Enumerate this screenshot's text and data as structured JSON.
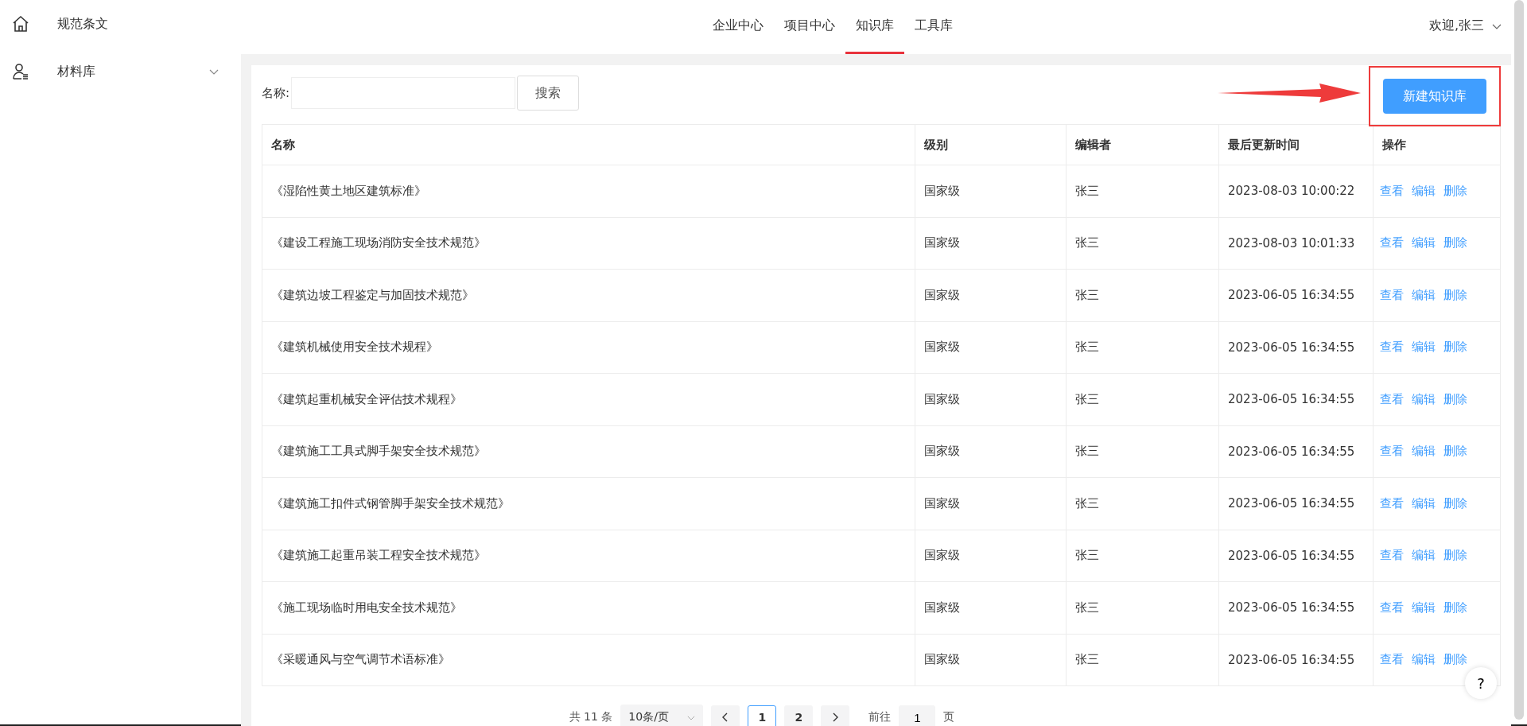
{
  "sidebar": {
    "items": [
      {
        "label": "规范条文",
        "kind": "home"
      },
      {
        "label": "材料库",
        "kind": "user-list",
        "expanded": false
      }
    ]
  },
  "nav": {
    "tabs": [
      {
        "label": "企业中心",
        "selected": false
      },
      {
        "label": "项目中心",
        "selected": false
      },
      {
        "label": "知识库",
        "selected": true
      },
      {
        "label": "工具库",
        "selected": false
      }
    ],
    "user": "欢迎,张三"
  },
  "search": {
    "label": "名称:",
    "button": "搜索"
  },
  "create_button": "新建知识库",
  "table": {
    "columns": [
      "名称",
      "级别",
      "编辑者",
      "最后更新时间",
      "操作"
    ],
    "rows": [
      {
        "cells": [
          "《湿陷性黄土地区建筑标准》",
          "国家级",
          "张三",
          "2023-08-03 10:00:22"
        ],
        "actions": [
          "查看",
          "编辑",
          "删除"
        ]
      },
      {
        "cells": [
          "《建设工程施工现场消防安全技术规范》",
          "国家级",
          "张三",
          "2023-08-03 10:01:33"
        ],
        "actions": [
          "查看",
          "编辑",
          "删除"
        ]
      },
      {
        "cells": [
          "《建筑边坡工程鉴定与加固技术规范》",
          "国家级",
          "张三",
          "2023-06-05 16:34:55"
        ],
        "actions": [
          "查看",
          "编辑",
          "删除"
        ]
      },
      {
        "cells": [
          "《建筑机械使用安全技术规程》",
          "国家级",
          "张三",
          "2023-06-05 16:34:55"
        ],
        "actions": [
          "查看",
          "编辑",
          "删除"
        ]
      },
      {
        "cells": [
          "《建筑起重机械安全评估技术规程》",
          "国家级",
          "张三",
          "2023-06-05 16:34:55"
        ],
        "actions": [
          "查看",
          "编辑",
          "删除"
        ]
      },
      {
        "cells": [
          "《建筑施工工具式脚手架安全技术规范》",
          "国家级",
          "张三",
          "2023-06-05 16:34:55"
        ],
        "actions": [
          "查看",
          "编辑",
          "删除"
        ]
      },
      {
        "cells": [
          "《建筑施工扣件式钢管脚手架安全技术规范》",
          "国家级",
          "张三",
          "2023-06-05 16:34:55"
        ],
        "actions": [
          "查看",
          "编辑",
          "删除"
        ]
      },
      {
        "cells": [
          "《建筑施工起重吊装工程安全技术规范》",
          "国家级",
          "张三",
          "2023-06-05 16:34:55"
        ],
        "actions": [
          "查看",
          "编辑",
          "删除"
        ]
      },
      {
        "cells": [
          "《施工现场临时用电安全技术规范》",
          "国家级",
          "张三",
          "2023-06-05 16:34:55"
        ],
        "actions": [
          "查看",
          "编辑",
          "删除"
        ]
      },
      {
        "cells": [
          "《采暖通风与空气调节术语标准》",
          "国家级",
          "张三",
          "2023-06-05 16:34:55"
        ],
        "actions": [
          "查看",
          "编辑",
          "删除"
        ]
      }
    ]
  },
  "help_button": "?",
  "pagination": {
    "total": "共 11 条",
    "page_size": "10条/页",
    "pages": [
      {
        "label": "1",
        "selected": true
      },
      {
        "label": "2",
        "selected": false
      }
    ],
    "goto_label": "前往",
    "goto_value": "1",
    "goto_suffix": "页"
  }
}
